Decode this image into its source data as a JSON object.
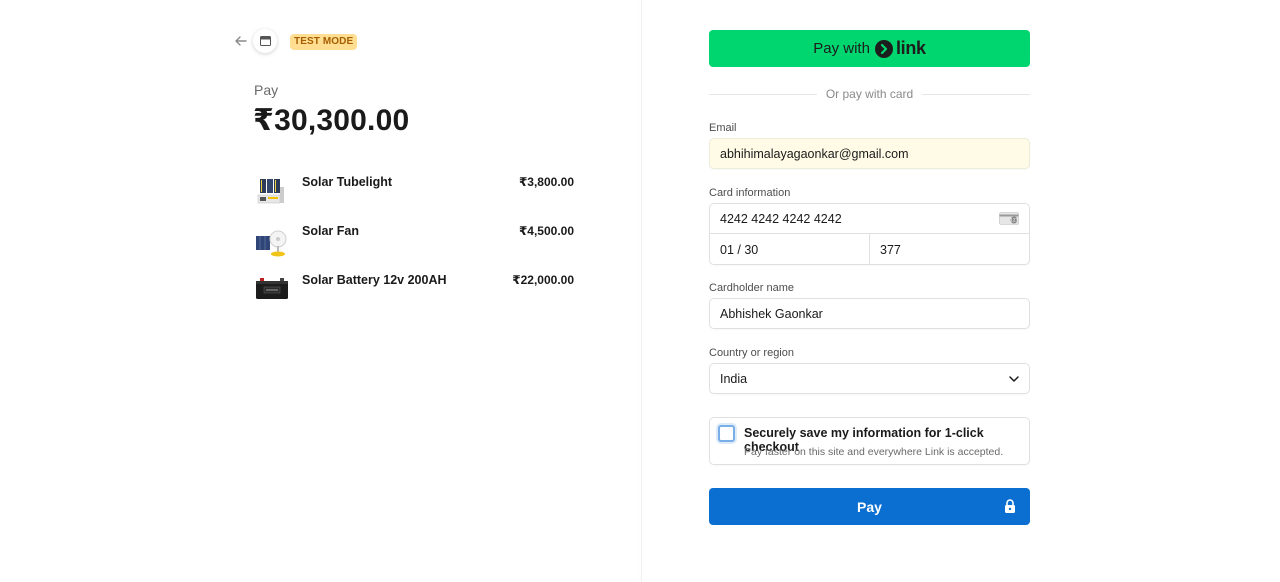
{
  "header": {
    "test_mode_badge": "TEST MODE"
  },
  "summary": {
    "pay_label": "Pay",
    "total": "₹30,300.00",
    "items": [
      {
        "name": "Solar Tubelight",
        "price": "₹3,800.00"
      },
      {
        "name": "Solar Fan",
        "price": "₹4,500.00"
      },
      {
        "name": "Solar Battery 12v 200AH",
        "price": "₹22,000.00"
      }
    ]
  },
  "link_button": {
    "label": "Pay with",
    "brand": "link"
  },
  "divider_text": "Or pay with card",
  "email": {
    "label": "Email",
    "value": "abhihimalayagaonkar@gmail.com"
  },
  "card": {
    "label": "Card information",
    "number": "4242 4242 4242 4242",
    "brand_icon": "VISA",
    "expiry": "01 / 30",
    "cvc": "377"
  },
  "cardholder": {
    "label": "Cardholder name",
    "value": "Abhishek Gaonkar"
  },
  "country": {
    "label": "Country or region",
    "value": "India"
  },
  "save_info": {
    "title": "Securely save my information for 1-click checkout",
    "subtitle": "Pay faster on this site and everywhere Link is accepted."
  },
  "pay_button": {
    "label": "Pay"
  },
  "colors": {
    "link_green": "#00d66f",
    "pay_blue": "#0a6fd1",
    "test_badge_bg": "#ffde92",
    "email_autofill_bg": "#fffbe6"
  }
}
